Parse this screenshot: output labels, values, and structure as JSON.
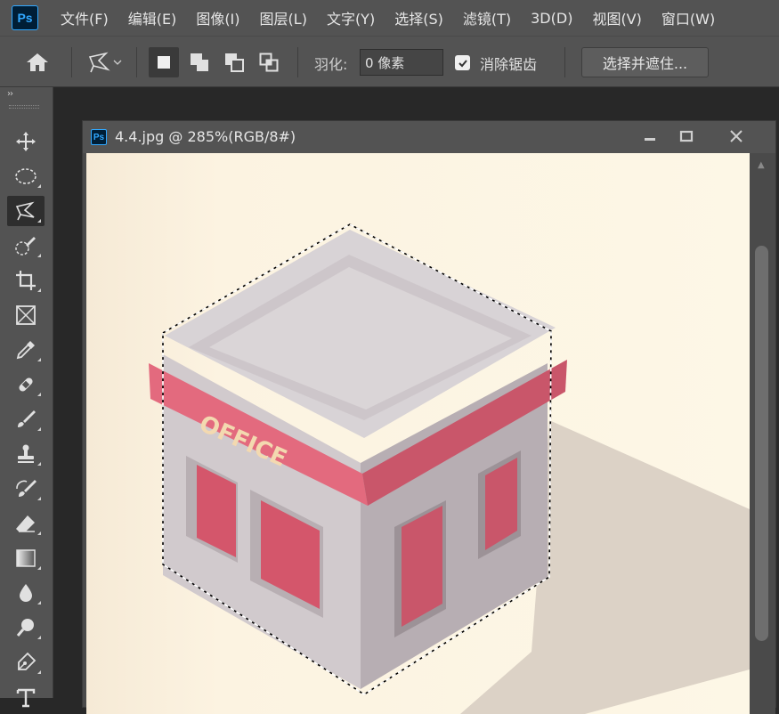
{
  "app": {
    "logo": "Ps",
    "menu": [
      "文件(F)",
      "编辑(E)",
      "图像(I)",
      "图层(L)",
      "文字(Y)",
      "选择(S)",
      "滤镜(T)",
      "3D(D)",
      "视图(V)",
      "窗口(W)"
    ]
  },
  "options": {
    "feather_label": "羽化:",
    "feather_value": "0 像素",
    "antialias_label": "消除锯齿",
    "antialias_checked": true,
    "select_mask_label": "选择并遮住..."
  },
  "toolbar": {
    "collapse": "››",
    "tools": [
      "move-tool",
      "elliptical-marquee-tool",
      "polygonal-lasso-tool",
      "quick-selection-tool",
      "crop-tool",
      "frame-tool",
      "eyedropper-tool",
      "healing-brush-tool",
      "brush-tool",
      "clone-stamp-tool",
      "history-brush-tool",
      "eraser-tool",
      "gradient-tool",
      "blur-tool",
      "dodge-tool",
      "pen-tool",
      "type-tool"
    ],
    "active_tool": "polygonal-lasso-tool"
  },
  "document": {
    "icon": "Ps",
    "title": "4.4.jpg @ 285%(RGB/8#)",
    "sign_text": "OFFICE"
  },
  "colors": {
    "ui_dark": "#535353",
    "canvas_bg": "#fdf6e4",
    "accent_ps": "#31a8ff",
    "building_red": "#d65a6e",
    "building_gray": "#c9c3c6"
  }
}
